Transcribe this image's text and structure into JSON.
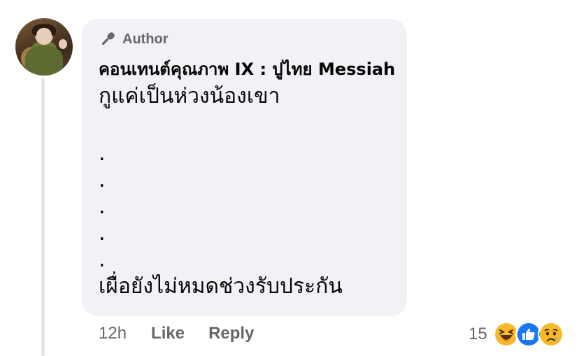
{
  "comment": {
    "badge": "Author",
    "author": "คอนเทนต์คุณภาพ IX : ปูไทย Messiah",
    "lines": [
      "กูแค่เป็นห่วงน้องเขา",
      ".",
      ".",
      ".",
      ".",
      ".",
      "เผื่อยังไม่หมดช่วงรับประกัน"
    ],
    "time": "12h",
    "like_label": "Like",
    "reply_label": "Reply",
    "reaction_count": "15",
    "reaction_icons": [
      "haha-icon",
      "like-icon",
      "sad-icon"
    ]
  },
  "colors": {
    "bubble": "#f0f2f5",
    "secondary_text": "#65676b",
    "like_blue": "#1877f2",
    "emoji_yellow": "#f7b928"
  }
}
